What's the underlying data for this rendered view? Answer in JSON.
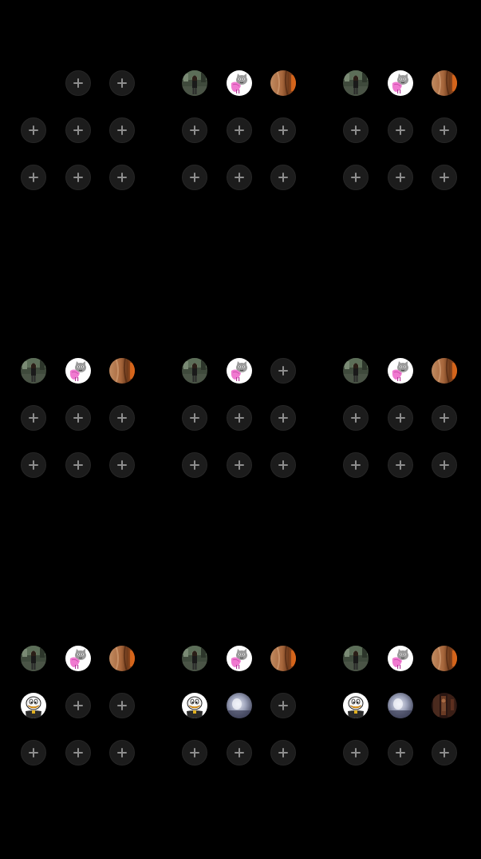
{
  "screen": {
    "background": "#000000",
    "empty_slot_color": "#1c1c1c",
    "plus_color": "#8e8e8e"
  },
  "panels": [
    {
      "name": "panel-1",
      "slots": [
        "blank",
        "add",
        "add",
        "add",
        "add",
        "add",
        "add",
        "add",
        "add"
      ]
    },
    {
      "name": "panel-2",
      "slots": [
        "avatar-person-street",
        "avatar-cartoon-cat-pink",
        "avatar-wood-orange",
        "add",
        "add",
        "add",
        "add",
        "add",
        "add"
      ]
    },
    {
      "name": "panel-3",
      "slots": [
        "avatar-person-street",
        "avatar-cartoon-cat-pink",
        "avatar-wood-orange",
        "add",
        "add",
        "add",
        "add",
        "add",
        "add"
      ]
    },
    {
      "name": "panel-4",
      "slots": [
        "avatar-person-street",
        "avatar-cartoon-cat-pink",
        "avatar-wood-orange",
        "add",
        "add",
        "add",
        "add",
        "add",
        "add"
      ]
    },
    {
      "name": "panel-5",
      "slots": [
        "avatar-person-street",
        "avatar-cartoon-cat-pink",
        "add",
        "add",
        "add",
        "add",
        "add",
        "add",
        "add"
      ]
    },
    {
      "name": "panel-6",
      "slots": [
        "avatar-person-street",
        "avatar-cartoon-cat-pink",
        "avatar-wood-orange",
        "add",
        "add",
        "add",
        "add",
        "add",
        "add"
      ]
    },
    {
      "name": "panel-7",
      "slots": [
        "avatar-person-street",
        "avatar-cartoon-cat-pink",
        "avatar-wood-orange",
        "avatar-cartoon-duck",
        "add",
        "add",
        "add",
        "add",
        "add"
      ]
    },
    {
      "name": "panel-8",
      "slots": [
        "avatar-person-street",
        "avatar-cartoon-cat-pink",
        "avatar-wood-orange",
        "avatar-cartoon-duck",
        "avatar-blurry-face",
        "add",
        "add",
        "add",
        "add"
      ]
    },
    {
      "name": "panel-9",
      "slots": [
        "avatar-person-street",
        "avatar-cartoon-cat-pink",
        "avatar-wood-orange",
        "avatar-cartoon-duck",
        "avatar-blurry-face",
        "avatar-dark-interior",
        "add",
        "add",
        "add"
      ]
    }
  ]
}
